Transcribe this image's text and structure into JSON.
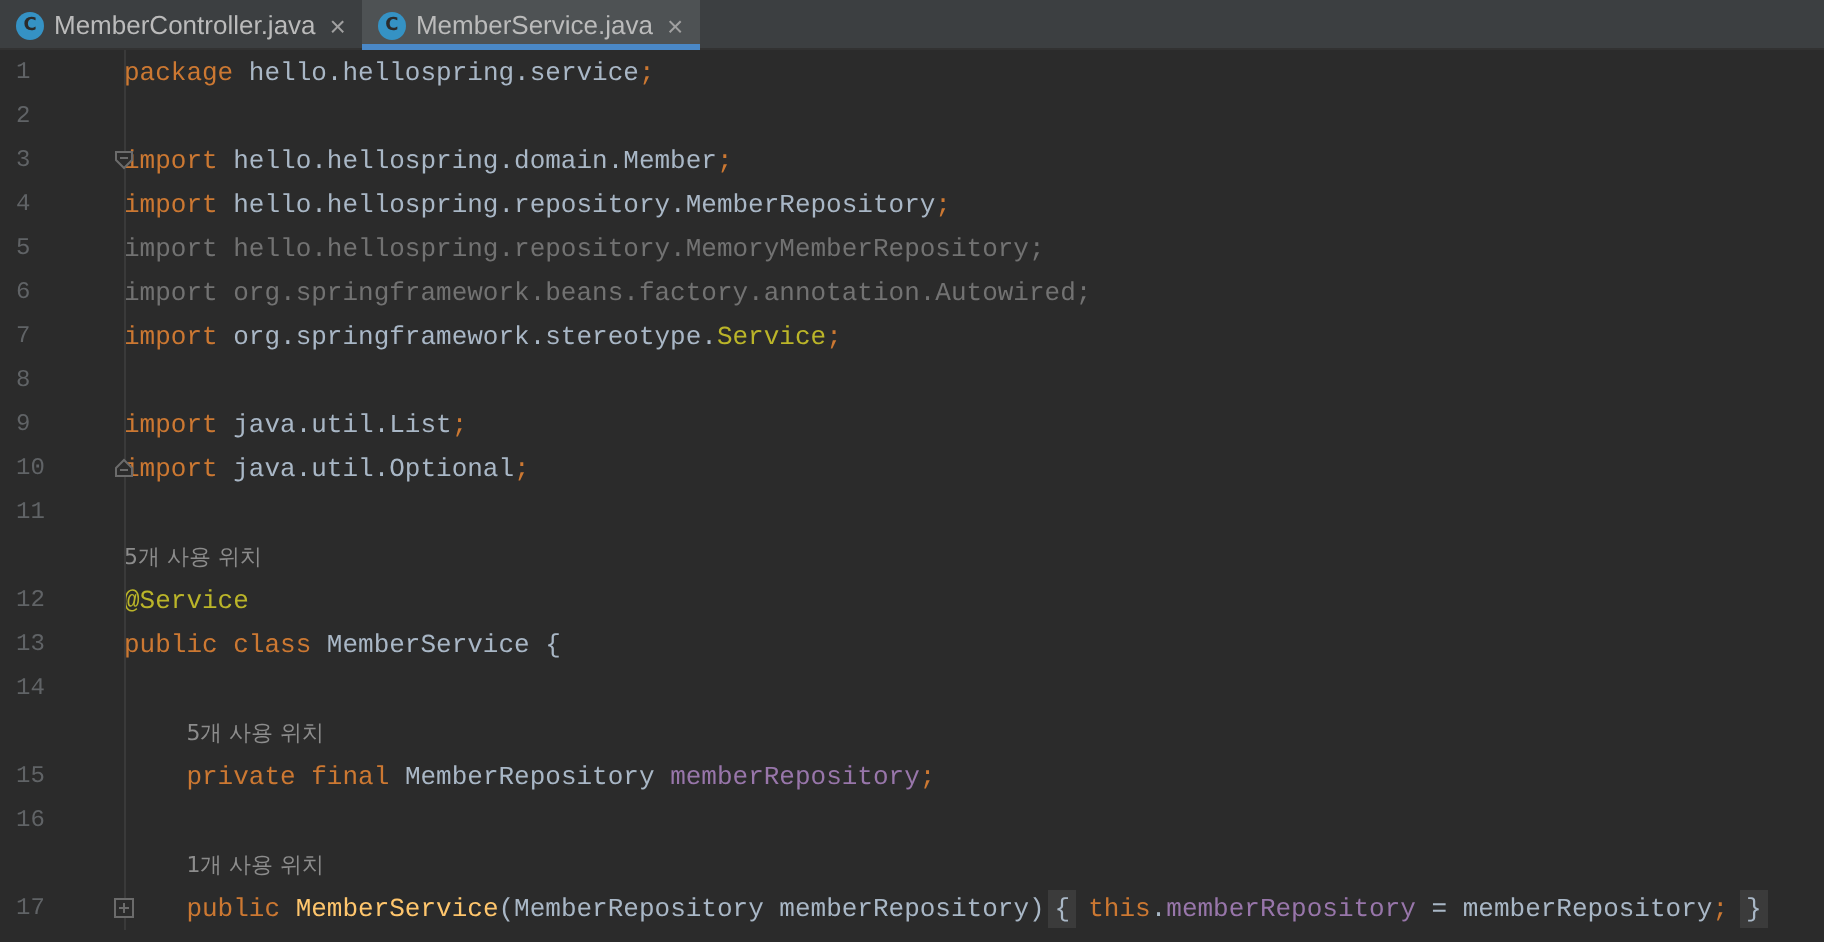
{
  "tabs": [
    {
      "icon_letter": "C",
      "label": "MemberController.java",
      "close": "×",
      "selected": false
    },
    {
      "icon_letter": "C",
      "label": "MemberService.java",
      "close": "×",
      "selected": true
    }
  ],
  "editor": {
    "lines": [
      {
        "kind": "code",
        "number": "1",
        "tokens": [
          {
            "text": "package ",
            "kind": "keyword"
          },
          {
            "text": "hello.hellospring.service",
            "kind": "plain"
          },
          {
            "text": ";",
            "kind": "keyword"
          }
        ]
      },
      {
        "kind": "code",
        "number": "2"
      },
      {
        "kind": "code",
        "number": "3",
        "fold": {
          "kind": "start"
        },
        "tokens": [
          {
            "text": "import ",
            "kind": "keyword"
          },
          {
            "text": "hello.hellospring.domain.Member",
            "kind": "plain"
          },
          {
            "text": ";",
            "kind": "keyword"
          }
        ]
      },
      {
        "kind": "code",
        "number": "4",
        "tokens": [
          {
            "text": "import ",
            "kind": "keyword"
          },
          {
            "text": "hello.hellospring.repository.MemberRepository",
            "kind": "plain"
          },
          {
            "text": ";",
            "kind": "keyword"
          }
        ]
      },
      {
        "kind": "code",
        "number": "5",
        "tokens": [
          {
            "text": "import hello.hellospring.repository.MemoryMemberRepository;",
            "kind": "unused"
          }
        ]
      },
      {
        "kind": "code",
        "number": "6",
        "tokens": [
          {
            "text": "import org.springframework.beans.factory.annotation.Autowired;",
            "kind": "unused"
          }
        ]
      },
      {
        "kind": "code",
        "number": "7",
        "tokens": [
          {
            "text": "import ",
            "kind": "keyword"
          },
          {
            "text": "org.springframework.stereotype.",
            "kind": "plain"
          },
          {
            "text": "Service",
            "kind": "annotation"
          },
          {
            "text": ";",
            "kind": "keyword"
          }
        ]
      },
      {
        "kind": "code",
        "number": "8"
      },
      {
        "kind": "code",
        "number": "9",
        "tokens": [
          {
            "text": "import ",
            "kind": "keyword"
          },
          {
            "text": "java.util.List",
            "kind": "plain"
          },
          {
            "text": ";",
            "kind": "keyword"
          }
        ]
      },
      {
        "kind": "code",
        "number": "10",
        "fold": {
          "kind": "end"
        },
        "tokens": [
          {
            "text": "import ",
            "kind": "keyword"
          },
          {
            "text": "java.util.Optional",
            "kind": "plain"
          },
          {
            "text": ";",
            "kind": "keyword"
          }
        ]
      },
      {
        "kind": "code",
        "number": "11"
      },
      {
        "kind": "hint",
        "text": "5개 사용 위치"
      },
      {
        "kind": "code",
        "number": "12",
        "tokens": [
          {
            "text": "@Service",
            "kind": "annotation"
          }
        ]
      },
      {
        "kind": "code",
        "number": "13",
        "tokens": [
          {
            "text": "public class ",
            "kind": "keyword"
          },
          {
            "text": "MemberService {",
            "kind": "plain"
          }
        ]
      },
      {
        "kind": "code",
        "number": "14"
      },
      {
        "kind": "hint",
        "text": "5개 사용 위치"
      },
      {
        "kind": "code",
        "number": "15",
        "tokens": [
          {
            "text": "    private final ",
            "kind": "keyword"
          },
          {
            "text": "MemberRepository ",
            "kind": "plain"
          },
          {
            "text": "memberRepository",
            "kind": "field"
          },
          {
            "text": ";",
            "kind": "keyword"
          }
        ]
      },
      {
        "kind": "code",
        "number": "16"
      },
      {
        "kind": "hint",
        "text": "1개 사용 위치"
      },
      {
        "kind": "code",
        "number": "17",
        "fold": {
          "kind": "collapsed"
        },
        "tokens": [
          {
            "text": "    public ",
            "kind": "keyword"
          },
          {
            "text": "MemberService",
            "kind": "method"
          },
          {
            "text": "(MemberRepository memberRepository)",
            "kind": "plain"
          },
          {
            "text": "{",
            "kind": "folded"
          },
          {
            "text": "this",
            "kind": "keyword"
          },
          {
            "text": ".",
            "kind": "plain"
          },
          {
            "text": "memberRepository",
            "kind": "field"
          },
          {
            "text": " = memberRepository",
            "kind": "plain"
          },
          {
            "text": ";",
            "kind": "keyword"
          },
          {
            "text": "}",
            "kind": "folded"
          }
        ]
      }
    ]
  }
}
